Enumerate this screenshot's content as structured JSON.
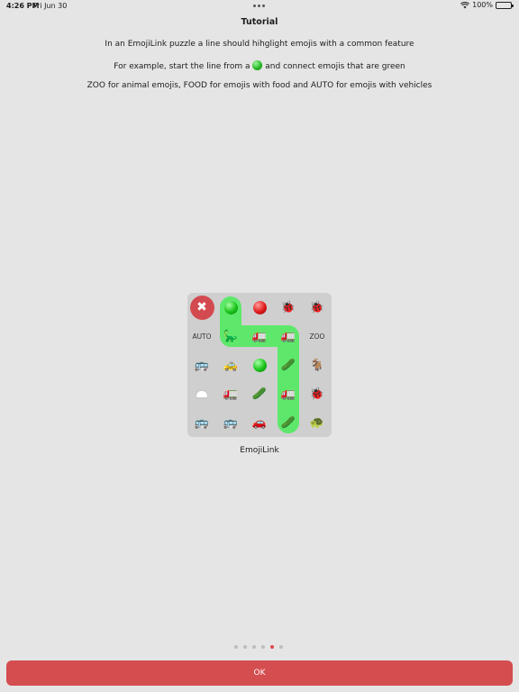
{
  "status": {
    "time": "4:26 PM",
    "date": "Fri Jun 30",
    "battery": "100%"
  },
  "tutorial": {
    "title": "Tutorial",
    "line1": "In an EmojiLink puzzle a line should hihglight emojis with a common feature",
    "line2_before": "For example, start the line from a",
    "line2_after": "and connect emojis that are green",
    "line3": "ZOO for animal emojis, FOOD for emojis with food and AUTO for emojis with vehicles"
  },
  "puzzle": {
    "labels": {
      "auto": "AUTO",
      "zoo": "ZOO"
    },
    "close_glyph": "✖",
    "emoji": {
      "ladybug": "🐞",
      "dinosaur": "🦕",
      "truck": "🚛",
      "goat": "🐐",
      "bus": "🚌",
      "taxi": "🚕",
      "cucumber": "🥒",
      "car": "🚗",
      "turtle": "🐢"
    },
    "caption": "EmojiLink",
    "highlight_color": "#5ee86b"
  },
  "pager": {
    "total": 6,
    "active_index": 4
  },
  "ok_button": {
    "label": "OK"
  },
  "colors": {
    "background": "#e5e5e5",
    "accent": "#d44d4f",
    "panel": "#cfcfcf"
  }
}
